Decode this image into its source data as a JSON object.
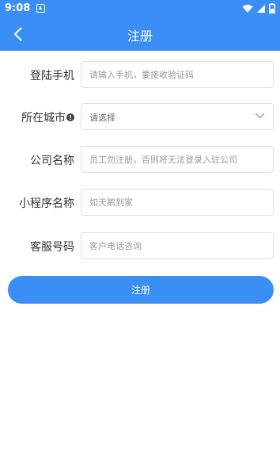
{
  "status_bar": {
    "time": "9:08",
    "icons": [
      "app-a-icon",
      "wifi-icon",
      "signal-icon",
      "battery-icon"
    ]
  },
  "header": {
    "title": "注册",
    "back_icon": "chevron-left-icon",
    "background": "#3a8ef6"
  },
  "form": {
    "phone": {
      "label": "登陆手机",
      "placeholder": "请输入手机，要接收验证码",
      "value": ""
    },
    "city": {
      "label": "所在城市",
      "value": "请选择",
      "info_icon": "info-icon",
      "chevron_icon": "chevron-down-icon"
    },
    "company": {
      "label": "公司名称",
      "placeholder": "员工勿注册，否则将无法登录入驻公司",
      "value": ""
    },
    "miniprogram": {
      "label": "小程序名称",
      "placeholder": "如天鹅到家",
      "value": ""
    },
    "service_phone": {
      "label": "客服号码",
      "placeholder": "客户电话咨询",
      "value": ""
    }
  },
  "submit": {
    "label": "注册"
  },
  "colors": {
    "accent": "#3a8ef6",
    "border": "#dcdfe6",
    "placeholder": "#999999"
  }
}
